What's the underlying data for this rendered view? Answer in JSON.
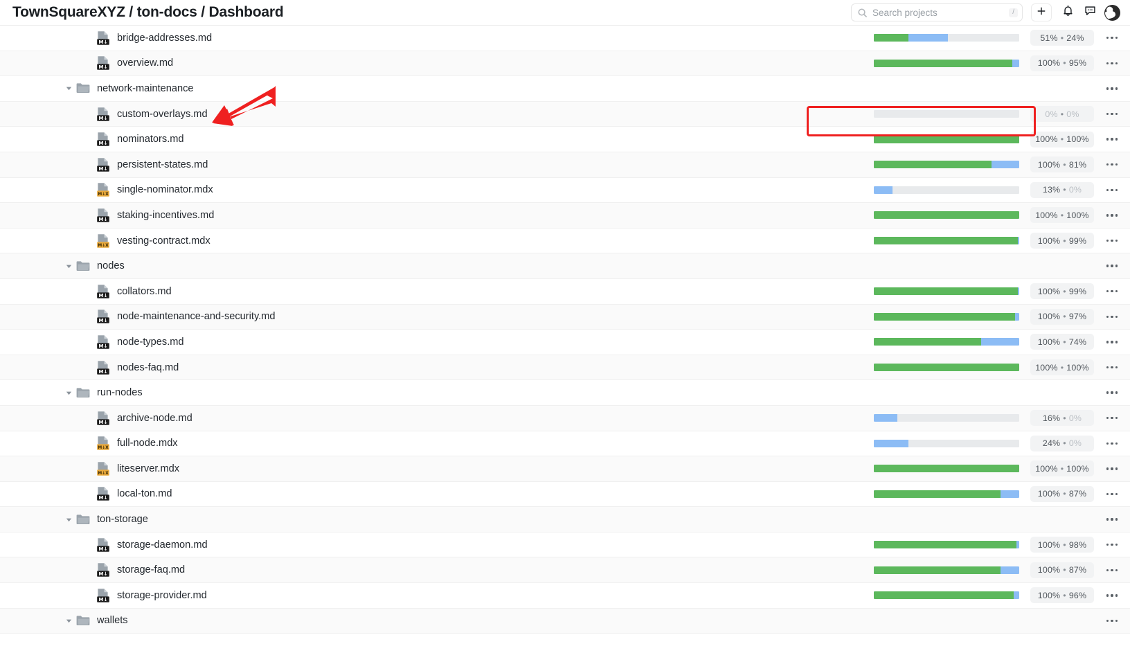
{
  "header": {
    "breadcrumb": "TownSquareXYZ / ton-docs / Dashboard",
    "search_placeholder": "Search projects",
    "search_value": "",
    "search_shortcut": "/",
    "icons": {
      "search": "search-icon",
      "plus": "plus-icon",
      "bell": "bell-icon",
      "chat": "chat-icon",
      "avatar": "user-avatar"
    }
  },
  "colors": {
    "green": "#5cb85c",
    "blue": "#8cbcf5",
    "track": "#e8eaec",
    "annotation_red": "#ef2020",
    "row_alt": "#fafafa"
  },
  "annotations": {
    "highlight_row": "custom-overlays.md",
    "arrow_points_to": "custom-overlays.md",
    "rect_label": "0% • 0%"
  },
  "rows": [
    {
      "type": "file",
      "name": "bridge-addresses.md",
      "ext": "md",
      "primary": 51,
      "secondary": 24,
      "pct": "51% • 24%"
    },
    {
      "type": "file",
      "name": "overview.md",
      "ext": "md",
      "primary": 100,
      "secondary": 95,
      "pct": "100% • 95%"
    },
    {
      "type": "folder",
      "name": "network-maintenance",
      "ext": "",
      "primary": null,
      "secondary": null,
      "pct": ""
    },
    {
      "type": "file",
      "name": "custom-overlays.md",
      "ext": "md",
      "primary": 0,
      "secondary": 0,
      "pct": "0% • 0%",
      "highlighted": true
    },
    {
      "type": "file",
      "name": "nominators.md",
      "ext": "md",
      "primary": 100,
      "secondary": 100,
      "pct": "100% • 100%"
    },
    {
      "type": "file",
      "name": "persistent-states.md",
      "ext": "md",
      "primary": 100,
      "secondary": 81,
      "pct": "100% • 81%"
    },
    {
      "type": "file",
      "name": "single-nominator.mdx",
      "ext": "mdx",
      "primary": 13,
      "secondary": 0,
      "pct": "13% • 0%"
    },
    {
      "type": "file",
      "name": "staking-incentives.md",
      "ext": "md",
      "primary": 100,
      "secondary": 100,
      "pct": "100% • 100%"
    },
    {
      "type": "file",
      "name": "vesting-contract.mdx",
      "ext": "mdx",
      "primary": 100,
      "secondary": 99,
      "pct": "100% • 99%"
    },
    {
      "type": "folder",
      "name": "nodes",
      "ext": "",
      "primary": null,
      "secondary": null,
      "pct": ""
    },
    {
      "type": "file",
      "name": "collators.md",
      "ext": "md",
      "primary": 100,
      "secondary": 99,
      "pct": "100% • 99%"
    },
    {
      "type": "file",
      "name": "node-maintenance-and-security.md",
      "ext": "md",
      "primary": 100,
      "secondary": 97,
      "pct": "100% • 97%"
    },
    {
      "type": "file",
      "name": "node-types.md",
      "ext": "md",
      "primary": 100,
      "secondary": 74,
      "pct": "100% • 74%"
    },
    {
      "type": "file",
      "name": "nodes-faq.md",
      "ext": "md",
      "primary": 100,
      "secondary": 100,
      "pct": "100% • 100%"
    },
    {
      "type": "folder",
      "name": "run-nodes",
      "ext": "",
      "primary": null,
      "secondary": null,
      "pct": ""
    },
    {
      "type": "file",
      "name": "archive-node.md",
      "ext": "md",
      "primary": 16,
      "secondary": 0,
      "pct": "16% • 0%"
    },
    {
      "type": "file",
      "name": "full-node.mdx",
      "ext": "mdx",
      "primary": 24,
      "secondary": 0,
      "pct": "24% • 0%"
    },
    {
      "type": "file",
      "name": "liteserver.mdx",
      "ext": "mdx",
      "primary": 100,
      "secondary": 100,
      "pct": "100% • 100%"
    },
    {
      "type": "file",
      "name": "local-ton.md",
      "ext": "md",
      "primary": 100,
      "secondary": 87,
      "pct": "100% • 87%"
    },
    {
      "type": "folder",
      "name": "ton-storage",
      "ext": "",
      "primary": null,
      "secondary": null,
      "pct": ""
    },
    {
      "type": "file",
      "name": "storage-daemon.md",
      "ext": "md",
      "primary": 100,
      "secondary": 98,
      "pct": "100% • 98%"
    },
    {
      "type": "file",
      "name": "storage-faq.md",
      "ext": "md",
      "primary": 100,
      "secondary": 87,
      "pct": "100% • 87%"
    },
    {
      "type": "file",
      "name": "storage-provider.md",
      "ext": "md",
      "primary": 100,
      "secondary": 96,
      "pct": "100% • 96%"
    },
    {
      "type": "folder",
      "name": "wallets",
      "ext": "",
      "primary": null,
      "secondary": null,
      "pct": ""
    }
  ]
}
